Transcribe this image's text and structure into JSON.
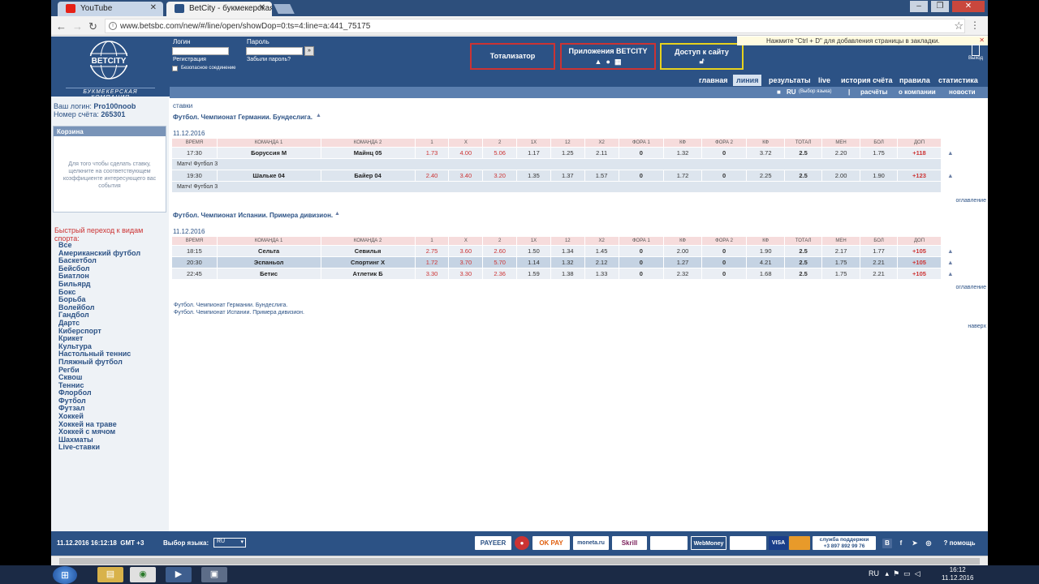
{
  "browser": {
    "tabs": [
      {
        "title": "YouTube",
        "icon_color": "#e62117"
      },
      {
        "title": "BetCity - букмекерская",
        "icon_color": "#2c5285"
      }
    ],
    "url": "www.betsbc.com/new/#/line/open/showDop=0:ts=4:line=a:441_75175"
  },
  "header": {
    "logo_text": "BETCITY",
    "logo_subtitle": "БУКМЕКЕРСКАЯ КОМПАНИЯ",
    "login_label": "Логин",
    "password_label": "Пароль",
    "register_link": "Регистрация",
    "forgot_link": "Забыли пароль?",
    "secure_label": "Безопасное соединение",
    "btn_totalizator": "Тотализатор",
    "btn_apps": "Приложения BETCITY",
    "btn_access": "Доступ к сайту",
    "bookmark_hint": "Нажмите \"Ctrl + D\" для добавления страницы в закладки.",
    "exit_label": "Выход"
  },
  "nav_main": [
    "главная",
    "линия",
    "результаты",
    "live",
    "история счёта",
    "правила",
    "статистика"
  ],
  "nav_sub": {
    "lang": "RU",
    "lang_hint": "(Выбор языка)",
    "items": [
      "расчёты",
      "о компании",
      "новости"
    ]
  },
  "sidebar": {
    "login_label": "Ваш логин:",
    "login_value": "Pro100noob",
    "account_label": "Номер счёта:",
    "account_value": "265301",
    "basket_title": "Корзина",
    "basket_text": "Для того чтобы сделать ставку, щелкните на соответствующем коэффициенте интересующего вас события",
    "quick_title": "Быстрый переход к видам спорта:",
    "sports": [
      "Все",
      "Американский футбол",
      "Баскетбол",
      "Бейсбол",
      "Биатлон",
      "Бильярд",
      "Бокс",
      "Борьба",
      "Волейбол",
      "Гандбол",
      "Дартс",
      "Киберспорт",
      "Крикет",
      "Культура",
      "Настольный теннис",
      "Пляжный футбол",
      "Регби",
      "Сквош",
      "Теннис",
      "Флорбол",
      "Футбол",
      "Футзал",
      "Хоккей",
      "Хоккей на траве",
      "Хоккей с мячом",
      "Шахматы",
      "Live-ставки"
    ]
  },
  "content": {
    "heading": "ставки",
    "columns": [
      "ВРЕМЯ",
      "КОМАНДА 1",
      "КОМАНДА 2",
      "1",
      "X",
      "2",
      "1X",
      "12",
      "X2",
      "ФОРА 1",
      "КФ",
      "ФОРА 2",
      "КФ",
      "ТОТАЛ",
      "МЕН",
      "БОЛ",
      "ДОП"
    ],
    "sections": [
      {
        "title": "Футбол. Чемпионат Германии. Бундеслига.",
        "date": "11.12.2016",
        "rows": [
          {
            "time": "17:30",
            "t1": "Боруссия М",
            "t2": "Майнц 05",
            "o1": "1.73",
            "ox": "4.00",
            "o2": "5.06",
            "o1x": "1.17",
            "o12": "1.25",
            "ox2": "2.11",
            "f1": "0",
            "k1": "1.32",
            "f2": "0",
            "k2": "3.72",
            "total": "2.5",
            "men": "2.20",
            "bol": "1.75",
            "dop": "+118",
            "info": "Матч! Футбол 3"
          },
          {
            "time": "19:30",
            "t1": "Шальке 04",
            "t2": "Байер 04",
            "o1": "2.40",
            "ox": "3.40",
            "o2": "3.20",
            "o1x": "1.35",
            "o12": "1.37",
            "ox2": "1.57",
            "f1": "0",
            "k1": "1.72",
            "f2": "0",
            "k2": "2.25",
            "total": "2.5",
            "men": "2.00",
            "bol": "1.90",
            "dop": "+123",
            "info": "Матч! Футбол 3"
          }
        ]
      },
      {
        "title": "Футбол. Чемпионат Испании. Примера дивизион.",
        "date": "11.12.2016",
        "rows": [
          {
            "time": "18:15",
            "t1": "Сельта",
            "t2": "Севилья",
            "o1": "2.75",
            "ox": "3.60",
            "o2": "2.60",
            "o1x": "1.50",
            "o12": "1.34",
            "ox2": "1.45",
            "f1": "0",
            "k1": "2.00",
            "f2": "0",
            "k2": "1.90",
            "total": "2.5",
            "men": "2.17",
            "bol": "1.77",
            "dop": "+105"
          },
          {
            "time": "20:30",
            "t1": "Эспаньол",
            "t2": "Спортинг Х",
            "o1": "1.72",
            "ox": "3.70",
            "o2": "5.70",
            "o1x": "1.14",
            "o12": "1.32",
            "ox2": "2.12",
            "f1": "0",
            "k1": "1.27",
            "f2": "0",
            "k2": "4.21",
            "total": "2.5",
            "men": "1.75",
            "bol": "2.21",
            "dop": "+105"
          },
          {
            "time": "22:45",
            "t1": "Бетис",
            "t2": "Атлетик Б",
            "o1": "3.30",
            "ox": "3.30",
            "o2": "2.36",
            "o1x": "1.59",
            "o12": "1.38",
            "ox2": "1.33",
            "f1": "0",
            "k1": "2.32",
            "f2": "0",
            "k2": "1.68",
            "total": "2.5",
            "men": "1.75",
            "bol": "2.21",
            "dop": "+105"
          }
        ]
      }
    ],
    "toc_label": "оглавление",
    "footer_links": [
      "Футбол. Чемпионат Германии. Бундеслига.",
      "Футбол. Чемпионат Испании. Примера дивизион."
    ],
    "top_label": "наверх"
  },
  "footer": {
    "datetime": "11.12.2016 16:12:18",
    "tz": "GMT +3",
    "lang_label": "Выбор языка:",
    "lang_value": "RU",
    "payments": [
      "PAYEER",
      "",
      "OK PAY",
      "moneta.ru",
      "Skrill",
      "",
      "WebMoney",
      "",
      "VISA",
      "",
      ""
    ],
    "support_line1": "служба поддержки",
    "support_line2": "+3 897 892 99 76",
    "help_label": "помощь"
  },
  "taskbar": {
    "lang": "RU",
    "time": "16:12",
    "date": "11.12.2016"
  }
}
